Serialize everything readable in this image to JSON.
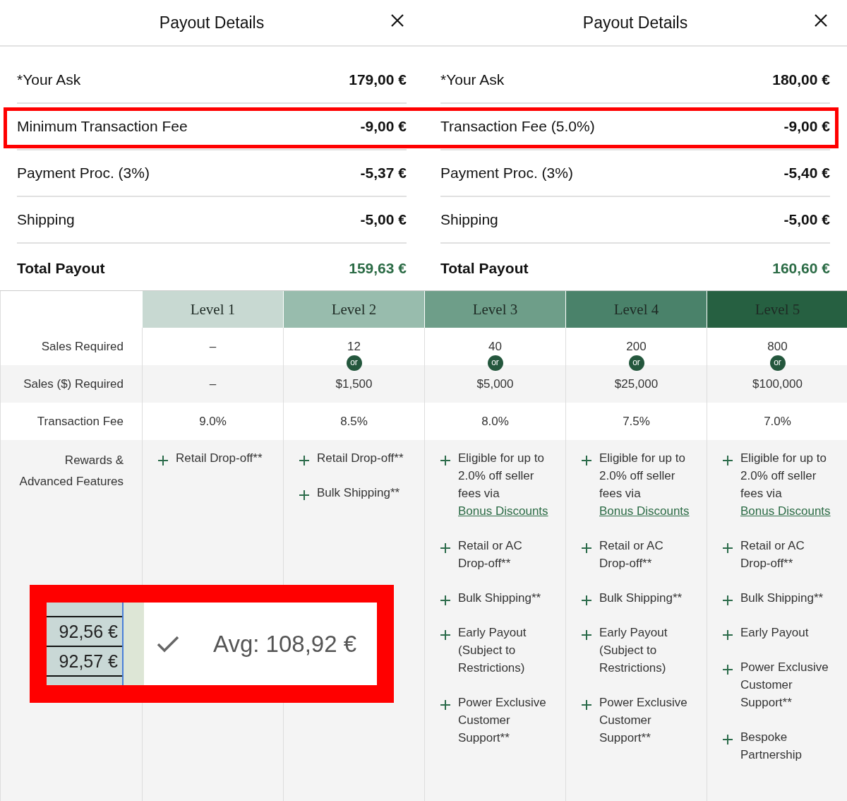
{
  "payout_panels": [
    {
      "title": "Payout Details",
      "rows": [
        {
          "kind": "line",
          "label": "*Your Ask",
          "value": "179,00 €",
          "highlighted": false
        },
        {
          "kind": "line",
          "label": "Minimum Transaction Fee",
          "value": "-9,00 €",
          "highlighted": true
        },
        {
          "kind": "line",
          "label": "Payment Proc. (3%)",
          "value": "-5,37 €",
          "highlighted": false
        },
        {
          "kind": "line",
          "label": "Shipping",
          "value": "-5,00 €",
          "highlighted": false
        },
        {
          "kind": "total",
          "label": "Total Payout",
          "value": "159,63 €",
          "highlighted": false
        }
      ]
    },
    {
      "title": "Payout Details",
      "rows": [
        {
          "kind": "line",
          "label": "*Your Ask",
          "value": "180,00 €",
          "highlighted": false
        },
        {
          "kind": "line",
          "label": "Transaction Fee (5.0%)",
          "value": "-9,00 €",
          "highlighted": true
        },
        {
          "kind": "line",
          "label": "Payment Proc. (3%)",
          "value": "-5,40 €",
          "highlighted": false
        },
        {
          "kind": "line",
          "label": "Shipping",
          "value": "-5,00 €",
          "highlighted": false
        },
        {
          "kind": "total",
          "label": "Total Payout",
          "value": "160,60 €",
          "highlighted": false
        }
      ]
    }
  ],
  "level_table": {
    "columns": [
      {
        "label": "Level 1",
        "color": "#c8d9d2"
      },
      {
        "label": "Level 2",
        "color": "#98bcad"
      },
      {
        "label": "Level 3",
        "color": "#6e9e89"
      },
      {
        "label": "Level 4",
        "color": "#4a826a"
      },
      {
        "label": "Level 5",
        "color": "#266041"
      }
    ],
    "rows": [
      {
        "kind": "value",
        "label": "Sales Required",
        "cells": [
          {
            "text": "–"
          },
          {
            "text": "12"
          },
          {
            "text": "40"
          },
          {
            "text": "200"
          },
          {
            "text": "800"
          }
        ]
      },
      {
        "kind": "value",
        "label": "Sales ($) Required",
        "cells": [
          {
            "text": "–"
          },
          {
            "text": "$1,500",
            "badge": "or"
          },
          {
            "text": "$5,000",
            "badge": "or"
          },
          {
            "text": "$25,000",
            "badge": "or"
          },
          {
            "text": "$100,000",
            "badge": "or"
          }
        ]
      },
      {
        "kind": "value",
        "label": "Transaction Fee",
        "cells": [
          {
            "text": "9.0%"
          },
          {
            "text": "8.5%"
          },
          {
            "text": "8.0%"
          },
          {
            "text": "7.5%"
          },
          {
            "text": "7.0%"
          }
        ]
      },
      {
        "kind": "features",
        "label": "Rewards & Advanced Features",
        "cells": [
          [
            {
              "text": "Retail Drop-off**"
            }
          ],
          [
            {
              "text": "Retail Drop-off**"
            },
            {
              "text": "Bulk Shipping**"
            }
          ],
          [
            {
              "text": "Eligible for up to 2.0% off seller fees via",
              "link": "Bonus Discounts"
            },
            {
              "text": "Retail or AC Drop-off**"
            },
            {
              "text": "Bulk Shipping**"
            },
            {
              "text": "Early Payout (Subject to Restrictions)"
            },
            {
              "text": "Power Exclusive Customer Support**"
            }
          ],
          [
            {
              "text": "Eligible for up to 2.0% off seller fees via",
              "link": "Bonus Discounts"
            },
            {
              "text": "Retail or AC Drop-off**"
            },
            {
              "text": "Bulk Shipping**"
            },
            {
              "text": "Early Payout (Subject to Restrictions)"
            },
            {
              "text": "Power Exclusive Customer Support**"
            }
          ],
          [
            {
              "text": "Eligible for up to 2.0% off seller fees via",
              "link": "Bonus Discounts"
            },
            {
              "text": "Retail or AC Drop-off**"
            },
            {
              "text": "Bulk Shipping**"
            },
            {
              "text": "Early Payout"
            },
            {
              "text": "Power Exclusive Customer Support**"
            },
            {
              "text": "Bespoke Partnership"
            }
          ]
        ]
      }
    ]
  },
  "inset": {
    "cells": [
      "92,56 €",
      "92,57 €"
    ],
    "average": "Avg: 108,92 €"
  }
}
